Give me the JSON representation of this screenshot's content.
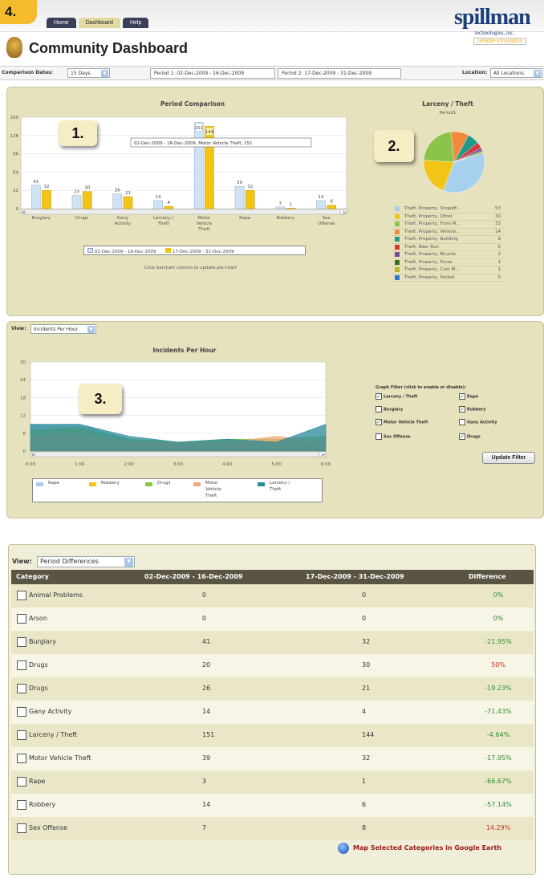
{
  "app": {
    "nav_tabs": [
      "Home",
      "Dashboard",
      "Help"
    ],
    "logo_main": "spillman",
    "logo_sub": "technologies, inc.",
    "logo_tag": "reliable innovation",
    "title": "Community Dashboard",
    "screenshot_marker": "4."
  },
  "filters": {
    "comparison_label": "Comparison Dates:",
    "comparison_value": "15 Days",
    "period1": "Period 1: 02-Dec-2009 - 16-Dec-2009",
    "period2": "Period 2: 17-Dec-2009 - 31-Dec-2009",
    "location_label": "Location:",
    "location_value": "All Locations"
  },
  "markers": [
    "1.",
    "2.",
    "3."
  ],
  "chart_data": [
    {
      "type": "bar",
      "title": "Period Comparison",
      "categories": [
        "Burglary",
        "Drugs",
        "Gany Activity",
        "Larceny / Theft",
        "Motor Vehicle Theft",
        "Rape",
        "Robbery",
        "Sex Offense"
      ],
      "category_lines": [
        [
          "Burglary"
        ],
        [
          "Drugs"
        ],
        [
          "Gany",
          "Activity"
        ],
        [
          "Larceny /",
          "Theft"
        ],
        [
          "Motor",
          "Vehicle",
          "Theft"
        ],
        [
          "Rape"
        ],
        [
          "Robbery"
        ],
        [
          "Sex",
          "Offense"
        ]
      ],
      "series": [
        {
          "name": "02-Dec-2009 - 16-Dec-2009",
          "color": "#cfe3f4",
          "values": [
            41,
            23,
            26,
            14,
            151,
            39,
            3,
            14
          ]
        },
        {
          "name": "17-Dec-2009 - 31-Dec-2009",
          "color": "#f2c418",
          "values": [
            32,
            30,
            21,
            4,
            144,
            32,
            1,
            6
          ]
        }
      ],
      "ylim": [
        0,
        160
      ],
      "yticks": [
        0,
        32,
        64,
        96,
        128,
        160
      ],
      "tooltip": "02-Dec-2009 - 16-Dec-2009, Motor Vehicle Theft, 151",
      "hint": "Click barchart column to update pie-chart"
    },
    {
      "type": "pie",
      "title": "Larceny / Theft",
      "subtitle": "Period1",
      "slices": [
        {
          "label": "Theft, Property, Shoplift...",
          "value": 53,
          "color": "#a6d0ee"
        },
        {
          "label": "Theft, Property, Other",
          "value": 30,
          "color": "#f2c418"
        },
        {
          "label": "Theft, Property, From M...",
          "value": 33,
          "color": "#8cc34a"
        },
        {
          "label": "Theft, Property, Vehicle...",
          "value": 14,
          "color": "#f08a3c"
        },
        {
          "label": "Theft, Property, Building",
          "value": 9,
          "color": "#1f9a8a"
        },
        {
          "label": "Theft, Beer Run",
          "value": 5,
          "color": "#d03a3a"
        },
        {
          "label": "Theft, Property, Bicycle",
          "value": 2,
          "color": "#7a4a9a"
        },
        {
          "label": "Theft, Property, Purse",
          "value": 1,
          "color": "#3a6a2a"
        },
        {
          "label": "Theft, Property, Coin M...",
          "value": 1,
          "color": "#b8b420"
        },
        {
          "label": "Theft, Property, Pocket",
          "value": 0,
          "color": "#2a7ad0"
        }
      ]
    },
    {
      "type": "area",
      "title": "Incidents Per Hour",
      "x": [
        0,
        1,
        2,
        3,
        4,
        5,
        6
      ],
      "xticks": [
        "0:00",
        "1:00",
        "2:00",
        "3:00",
        "4:00",
        "5:00",
        "6:00"
      ],
      "ylim": [
        0,
        30
      ],
      "yticks": [
        0,
        6,
        12,
        18,
        24,
        30
      ],
      "series": [
        {
          "name": "Rape",
          "color": "#a6d0ee",
          "values": [
            9,
            9,
            4,
            3,
            4,
            3,
            1
          ]
        },
        {
          "name": "Robbery",
          "color": "#f2c418",
          "values": [
            6,
            7,
            3,
            3,
            3,
            4,
            2
          ]
        },
        {
          "name": "Drugs",
          "color": "#8cc34a",
          "values": [
            7,
            8,
            4,
            3,
            4,
            4,
            5
          ]
        },
        {
          "name": "Motor Vehicle Theft",
          "color": "#f0a878",
          "values": [
            5,
            6,
            3,
            3,
            3,
            5,
            3
          ]
        },
        {
          "name": "Larceny / Theft",
          "color": "#2a8a9a",
          "values": [
            9,
            9,
            5,
            3,
            4,
            3,
            9
          ]
        }
      ],
      "legend_lines": [
        [
          "Rape"
        ],
        [
          "Robbery"
        ],
        [
          "Drugs"
        ],
        [
          "Motor",
          "Vehicle",
          "Theft"
        ],
        [
          "Larceny /",
          "Theft"
        ]
      ]
    }
  ],
  "view1": {
    "label": "View:",
    "value": "Incidents Per Hour"
  },
  "graph_filter": {
    "title": "Graph Filter (click to enable or disable):",
    "items": [
      {
        "label": "Larceny / Theft",
        "checked": true
      },
      {
        "label": "Rape",
        "checked": true
      },
      {
        "label": "Burglary",
        "checked": false
      },
      {
        "label": "Robbery",
        "checked": true
      },
      {
        "label": "Motor Vehicle Theft",
        "checked": true
      },
      {
        "label": "Gany Activity",
        "checked": false
      },
      {
        "label": "Sex Offense",
        "checked": false
      },
      {
        "label": "Drugs",
        "checked": true
      }
    ],
    "button": "Update Filter"
  },
  "view2": {
    "label": "View:",
    "value": "Period Differences"
  },
  "table": {
    "headers": [
      "Category",
      "02-Dec-2009 - 16-Dec-2009",
      "17-Dec-2009 - 31-Dec-2009",
      "Difference"
    ],
    "rows": [
      [
        "Animal Problems",
        "0",
        "0",
        "0%"
      ],
      [
        "Arson",
        "0",
        "0",
        "0%"
      ],
      [
        "Burglary",
        "41",
        "32",
        "-21.95%"
      ],
      [
        "Drugs",
        "20",
        "30",
        "50%"
      ],
      [
        "Drugs",
        "26",
        "21",
        "-19.23%"
      ],
      [
        "Gany Activity",
        "14",
        "4",
        "-71.43%"
      ],
      [
        "Larceny / Theft",
        "151",
        "144",
        "-4.64%"
      ],
      [
        "Motor Vehicle Theft",
        "39",
        "32",
        "-17.95%"
      ],
      [
        "Rape",
        "3",
        "1",
        "-66.67%"
      ],
      [
        "Robbery",
        "14",
        "6",
        "-57.14%"
      ],
      [
        "Sex Offense",
        "7",
        "8",
        "14.29%"
      ]
    ],
    "positive_color": "#d03020",
    "negative_color": "#2e8a2e"
  },
  "map_link": "Map Selected Categories in Google Earth"
}
